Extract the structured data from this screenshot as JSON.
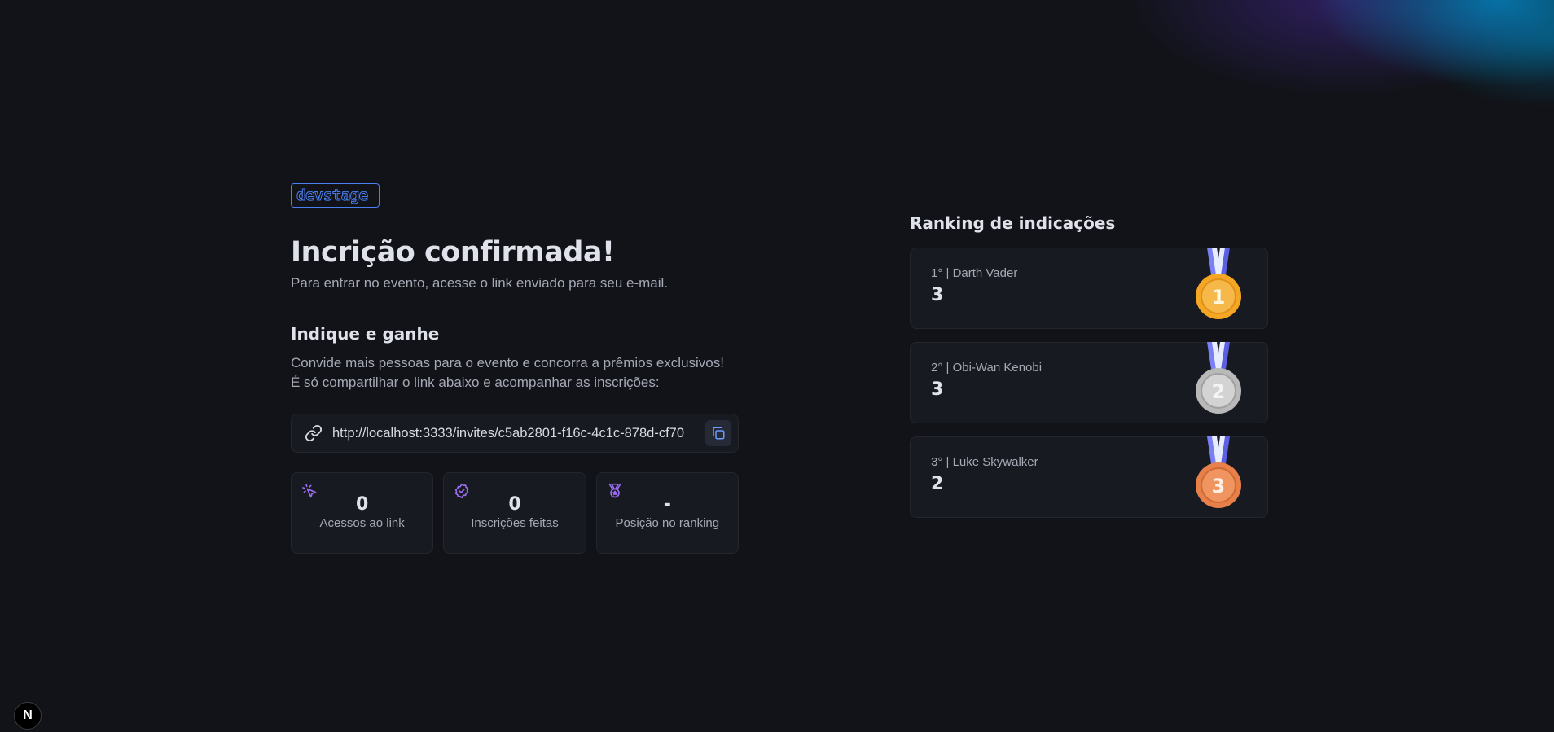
{
  "brand": {
    "logo_text": "devstage",
    "accent_color": "#4a7ff0"
  },
  "confirmation": {
    "title": "Incrição confirmada!",
    "subtitle": "Para entrar no evento, acesse o link enviado para seu e-mail."
  },
  "referral": {
    "heading": "Indique e ganhe",
    "description_line1": "Convide mais pessoas para o evento e concorra a prêmios exclusivos!",
    "description_line2": "É só compartilhar o link abaixo e acompanhar as inscrições:",
    "link_icon": "link-icon",
    "invite_link": "http://localhost:3333/invites/c5ab2801-f16c-4c1c-878d-cf70",
    "copy_icon": "copy-icon"
  },
  "stats": [
    {
      "icon": "cursor-click-icon",
      "value": "0",
      "label": "Acessos ao link"
    },
    {
      "icon": "badge-check-icon",
      "value": "0",
      "label": "Inscrições feitas"
    },
    {
      "icon": "medal-icon",
      "value": "-",
      "label": "Posição no ranking"
    }
  ],
  "ranking": {
    "title": "Ranking de indicações",
    "entries": [
      {
        "label": "1° | Darth Vader",
        "score": "3",
        "medal": "gold-medal-icon",
        "medal_number": "1",
        "medal_color": "#f5a623"
      },
      {
        "label": "2° | Obi-Wan Kenobi",
        "score": "3",
        "medal": "silver-medal-icon",
        "medal_number": "2",
        "medal_color": "#c4c4c4"
      },
      {
        "label": "3° | Luke Skywalker",
        "score": "2",
        "medal": "bronze-medal-icon",
        "medal_number": "3",
        "medal_color": "#e8804a"
      }
    ]
  },
  "dev_badge": {
    "icon": "nextjs-icon",
    "text": "N"
  }
}
